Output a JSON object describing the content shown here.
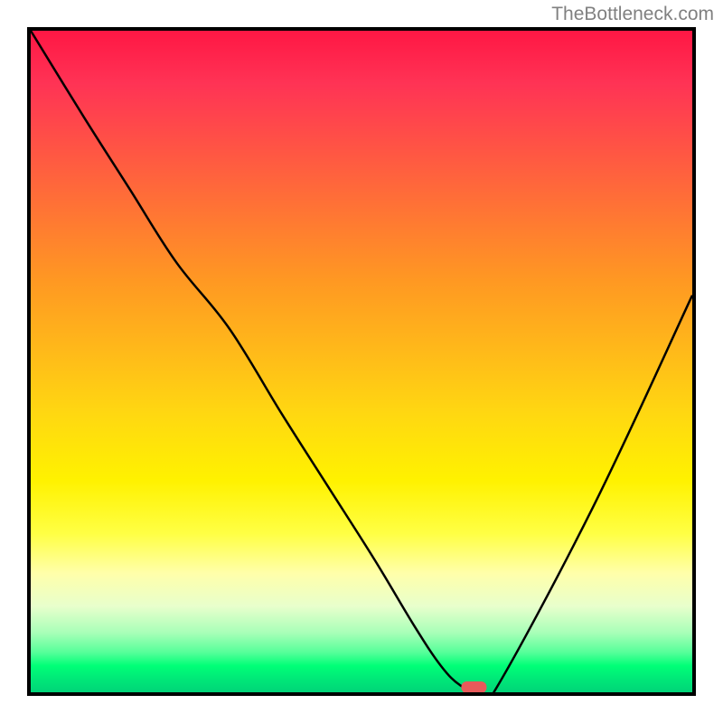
{
  "attribution": "TheBottleneck.com",
  "chart_data": {
    "type": "line",
    "title": "",
    "xlabel": "",
    "ylabel": "",
    "xlim": [
      0,
      100
    ],
    "ylim": [
      0,
      100
    ],
    "grid": false,
    "series": [
      {
        "name": "bottleneck-curve",
        "x": [
          0,
          8,
          15,
          22,
          30,
          38,
          45,
          52,
          58,
          62,
          65,
          68,
          70,
          85,
          100
        ],
        "y": [
          100,
          87,
          76,
          65,
          55,
          42,
          31,
          20,
          10,
          4,
          1,
          0,
          0,
          28,
          60
        ]
      }
    ],
    "marker": {
      "x": 67,
      "y": 0,
      "color": "#e85a5a"
    },
    "background_gradient": {
      "top": "#ff1744",
      "middle": "#ffdd00",
      "bottom": "#00d478"
    }
  }
}
